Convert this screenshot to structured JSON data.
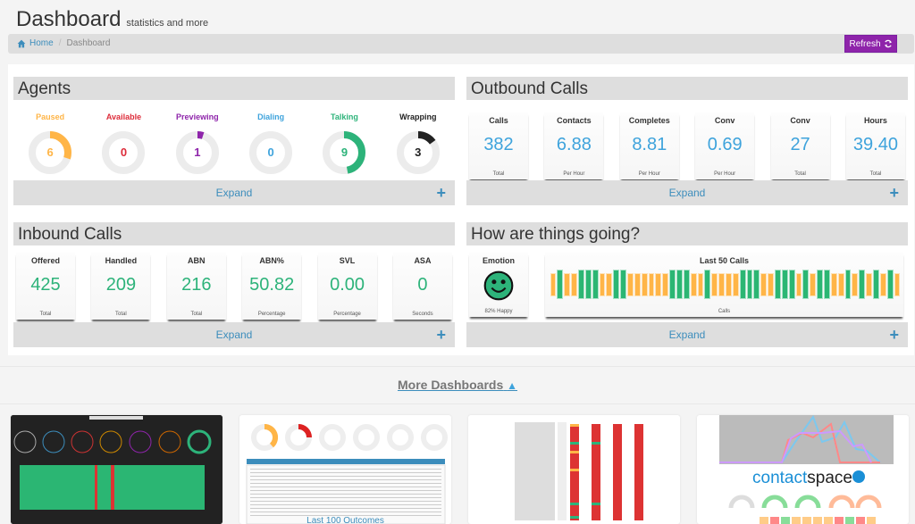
{
  "header": {
    "title": "Dashboard",
    "subtitle": "statistics and more"
  },
  "breadcrumb": {
    "home": "Home",
    "separator": "/",
    "current": "Dashboard"
  },
  "toolbar": {
    "refresh_label": "Refresh"
  },
  "agents": {
    "title": "Agents",
    "expand_label": "Expand",
    "items": [
      {
        "label": "Paused",
        "value": 6,
        "fraction": 0.3,
        "color": "#ffb547"
      },
      {
        "label": "Available",
        "value": 0,
        "fraction": 0,
        "color": "#dd2c3a"
      },
      {
        "label": "Previewing",
        "value": 1,
        "fraction": 0.05,
        "color": "#8e24aa"
      },
      {
        "label": "Dialing",
        "value": 0,
        "fraction": 0,
        "color": "#3ea3dc"
      },
      {
        "label": "Talking",
        "value": 9,
        "fraction": 0.47,
        "color": "#2db37a"
      },
      {
        "label": "Wrapping",
        "value": 3,
        "fraction": 0.15,
        "color": "#222222"
      }
    ]
  },
  "outbound": {
    "title": "Outbound Calls",
    "expand_label": "Expand",
    "tiles": [
      {
        "label": "Calls",
        "value": "382",
        "sub": "Total"
      },
      {
        "label": "Contacts",
        "value": "6.88",
        "sub": "Per Hour"
      },
      {
        "label": "Completes",
        "value": "8.81",
        "sub": "Per Hour"
      },
      {
        "label": "Conv",
        "value": "0.69",
        "sub": "Per Hour"
      },
      {
        "label": "Conv",
        "value": "27",
        "sub": "Total"
      },
      {
        "label": "Hours",
        "value": "39.40",
        "sub": "Total"
      }
    ]
  },
  "inbound": {
    "title": "Inbound Calls",
    "expand_label": "Expand",
    "tiles": [
      {
        "label": "Offered",
        "value": "425",
        "sub": "Total"
      },
      {
        "label": "Handled",
        "value": "209",
        "sub": "Total"
      },
      {
        "label": "ABN",
        "value": "216",
        "sub": "Total"
      },
      {
        "label": "ABN%",
        "value": "50.82",
        "sub": "Percentage"
      },
      {
        "label": "SVL",
        "value": "0.00",
        "sub": "Percentage"
      },
      {
        "label": "ASA",
        "value": "0",
        "sub": "Seconds"
      }
    ]
  },
  "going": {
    "title": "How are things going?",
    "expand_label": "Expand",
    "emotion": {
      "label": "Emotion",
      "icon": "smiley-face-icon",
      "sub": "82% Happy",
      "color": "#2db37a"
    },
    "last_calls": {
      "label": "Last 50 Calls",
      "sub": "Calls",
      "sequence": [
        "O",
        "G",
        "O",
        "O",
        "G",
        "G",
        "G",
        "O",
        "O",
        "G",
        "G",
        "O",
        "O",
        "O",
        "O",
        "O",
        "O",
        "G",
        "G",
        "G",
        "O",
        "O",
        "G",
        "O",
        "O",
        "O",
        "O",
        "G",
        "G",
        "G",
        "O",
        "O",
        "G",
        "G",
        "G",
        "O",
        "G",
        "O",
        "G",
        "G",
        "O",
        "O",
        "G",
        "O",
        "G",
        "O",
        "G",
        "O",
        "G",
        "O"
      ],
      "legend": {
        "G": "#2bb673",
        "O": "#ffb547"
      }
    }
  },
  "more_dashboards": {
    "label": "More Dashboards",
    "thumbnails": [
      {
        "name": "dark-wallboard",
        "caption": ""
      },
      {
        "name": "outcomes",
        "caption": "Last 100 Outcomes"
      },
      {
        "name": "campaign-table",
        "caption": ""
      },
      {
        "name": "contactspace-overview",
        "caption": "",
        "brand": "contactspace"
      }
    ]
  }
}
